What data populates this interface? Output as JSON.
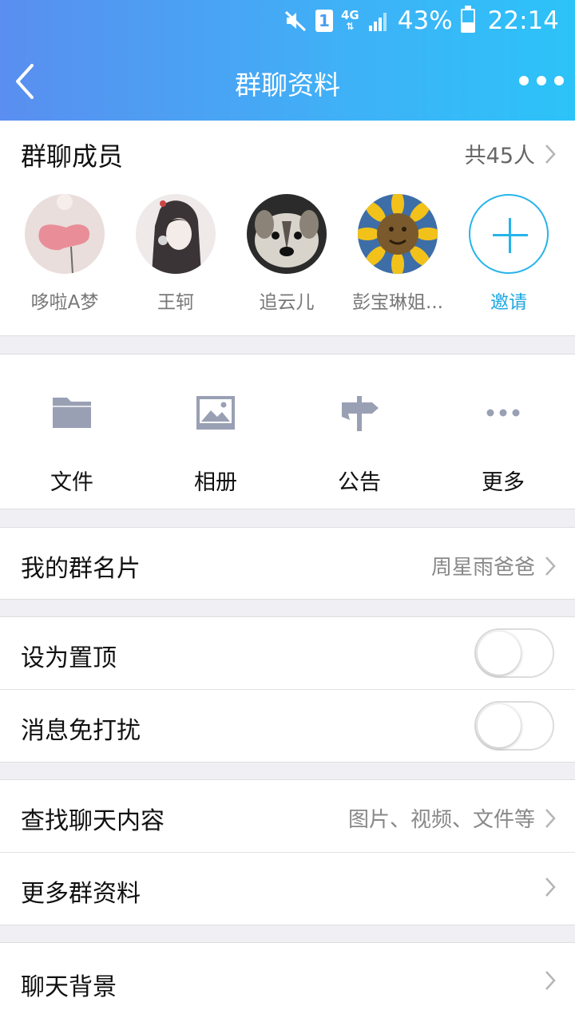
{
  "status_bar": {
    "sim_label": "1",
    "network": "4G",
    "battery_percent": "43%",
    "battery_level": 0.43,
    "time": "22:14"
  },
  "navbar": {
    "title": "群聊资料"
  },
  "members": {
    "title": "群聊成员",
    "count_label": "共45人",
    "list": [
      {
        "name": "哆啦A梦"
      },
      {
        "name": "王轲"
      },
      {
        "name": "追云儿"
      },
      {
        "name": "彭宝琳姐..."
      }
    ],
    "invite_label": "邀请"
  },
  "tools": {
    "files": "文件",
    "album": "相册",
    "notice": "公告",
    "more": "更多"
  },
  "card": {
    "label": "我的群名片",
    "value": "周星雨爸爸"
  },
  "pin": {
    "label": "设为置顶",
    "on": false
  },
  "mute": {
    "label": "消息免打扰",
    "on": false
  },
  "search": {
    "label": "查找聊天内容",
    "hint": "图片、视频、文件等"
  },
  "more_info": {
    "label": "更多群资料"
  },
  "background": {
    "label": "聊天背景"
  },
  "colors": {
    "accent": "#26b4ea",
    "header_start": "#5a8ef0",
    "header_end": "#2cc3f8",
    "icon_gray": "#9aa0b4"
  }
}
